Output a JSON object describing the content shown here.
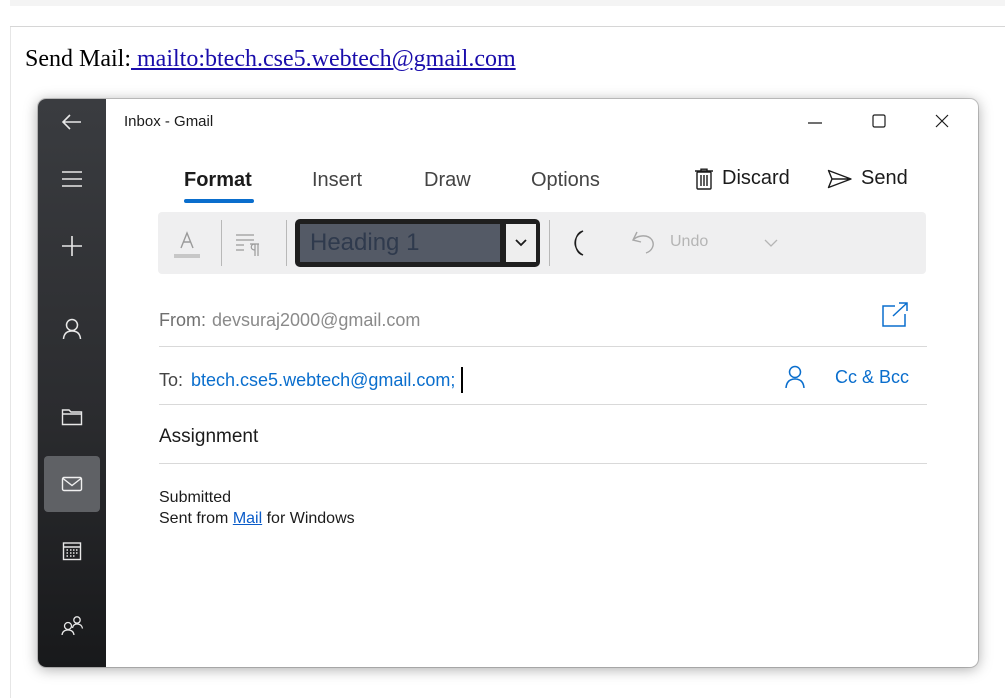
{
  "page": {
    "send_label": "Send Mail:",
    "mailto_text": " mailto:btech.cse5.webtech@gmail.com"
  },
  "window": {
    "title": "Inbox - Gmail"
  },
  "nav_rail": {
    "icons": [
      "back-arrow-icon",
      "hamburger-menu-icon",
      "new-mail-icon",
      "account-icon",
      "folder-icon",
      "mail-icon",
      "calendar-icon",
      "people-icon"
    ],
    "active": "mail"
  },
  "ribbon": {
    "tabs": [
      {
        "label": "Format",
        "active": true
      },
      {
        "label": "Insert",
        "active": false
      },
      {
        "label": "Draw",
        "active": false
      },
      {
        "label": "Options",
        "active": false
      }
    ],
    "discard_label": "Discard",
    "send_label": "Send"
  },
  "toolbar": {
    "style_value": "Heading 1",
    "undo_label": "Undo"
  },
  "compose": {
    "from_label": "From:",
    "from_value": "devsuraj2000@gmail.com",
    "to_label": "To:",
    "to_value": "btech.cse5.webtech@gmail.com;",
    "cc_bcc_label": "Cc & Bcc",
    "subject": "Assignment",
    "body_line1": "Submitted",
    "signature_prefix": "Sent from ",
    "signature_link": "Mail",
    "signature_suffix": " for Windows"
  },
  "colors": {
    "accent": "#0a6ecd",
    "rail_bg": "#2b2c2f"
  }
}
